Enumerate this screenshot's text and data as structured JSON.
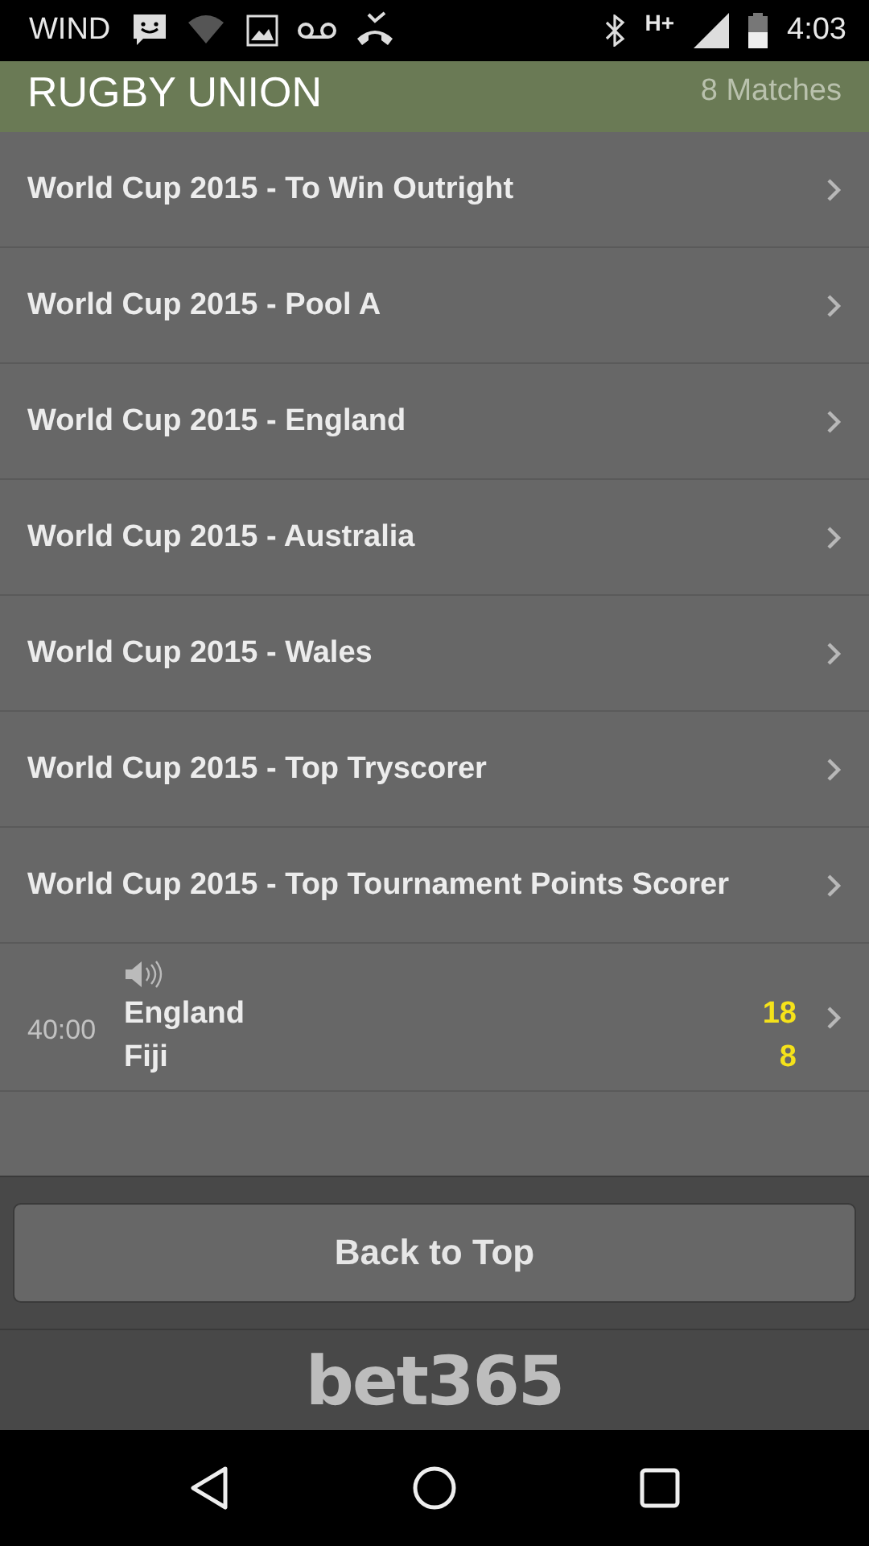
{
  "status_bar": {
    "carrier": "WIND",
    "network": "H+",
    "time": "4:03"
  },
  "header": {
    "title": "RUGBY UNION",
    "count": "8 Matches"
  },
  "competitions": [
    {
      "label": "World Cup 2015 - To Win Outright"
    },
    {
      "label": "World Cup 2015 - Pool A"
    },
    {
      "label": "World Cup 2015 - England"
    },
    {
      "label": "World Cup 2015 - Australia"
    },
    {
      "label": "World Cup 2015 - Wales"
    },
    {
      "label": "World Cup 2015 - Top Tryscorer"
    },
    {
      "label": "World Cup 2015 - Top Tournament Points Scorer"
    }
  ],
  "live_match": {
    "clock": "40:00",
    "teams": [
      {
        "name": "England",
        "score": "18"
      },
      {
        "name": "Fiji",
        "score": "8"
      }
    ]
  },
  "back_button": "Back to Top",
  "logo": "bet365"
}
